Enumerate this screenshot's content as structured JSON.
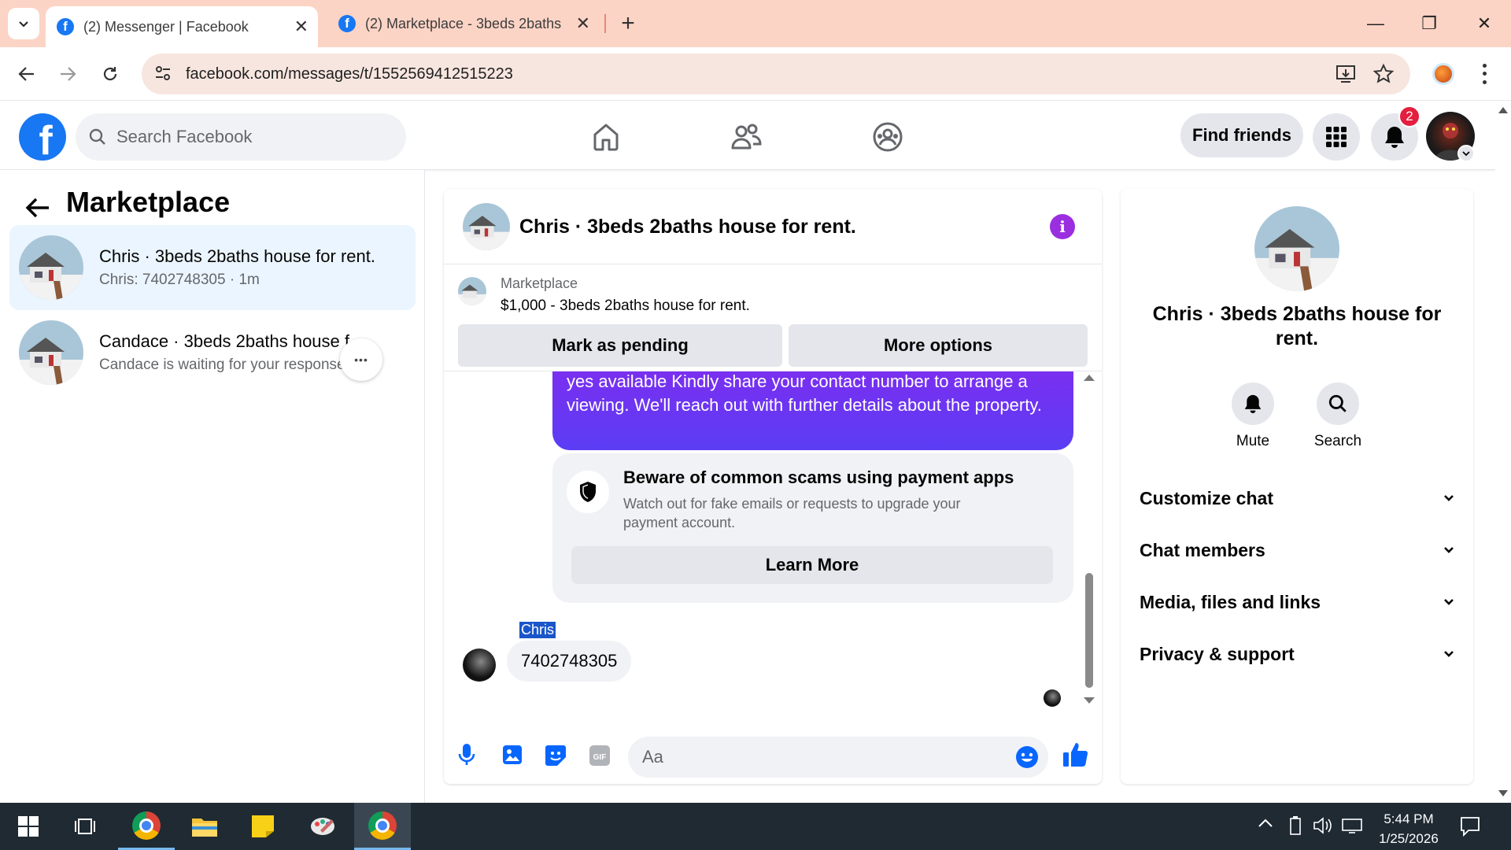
{
  "browser": {
    "tabs": [
      {
        "title": "(2) Messenger | Facebook",
        "active": true
      },
      {
        "title": "(2) Marketplace - 3beds 2baths",
        "active": false
      }
    ],
    "url": "facebook.com/messages/t/1552569412515223",
    "new_tab_label": "+",
    "tab_close_glyph": "✕",
    "tab_list_glyph": "⌄",
    "window": {
      "minimize": "—",
      "restore": "❐",
      "close": "✕"
    }
  },
  "facebook_header": {
    "logo_letter": "f",
    "search_placeholder": "Search Facebook",
    "find_friends_label": "Find friends",
    "notification_count": "2",
    "accent": "#1877f2"
  },
  "left_panel": {
    "title": "Marketplace",
    "conversations": [
      {
        "name": "Chris · 3beds 2baths house for rent.",
        "preview": "Chris: 7402748305 · 1m",
        "active": true
      },
      {
        "name": "Candace · 3beds 2baths house f…",
        "preview": "Candace is waiting for your response · 1m",
        "active": false
      }
    ],
    "more_glyph": "•••"
  },
  "chat": {
    "title": "Chris · 3beds 2baths house for rent.",
    "info_glyph": "i",
    "marketplace_label": "Marketplace",
    "listing": "$1,000 - 3beds 2baths house for rent.",
    "mark_pending_label": "Mark as pending",
    "more_options_label": "More options",
    "outgoing_message": "yes available Kindly share your contact number to arrange a viewing. We'll reach out with further details about the property.",
    "scam_card": {
      "title": "Beware of common scams using payment apps",
      "body": "Watch out for fake emails or requests to upgrade your payment account.",
      "button": "Learn More"
    },
    "incoming_sender": "Chris",
    "incoming_message": "7402748305",
    "input_placeholder": "Aa",
    "bubble_color": "#6c2ff6"
  },
  "right_panel": {
    "name": "Chris · 3beds 2baths house for rent.",
    "actions": [
      {
        "label": "Mute"
      },
      {
        "label": "Search"
      }
    ],
    "sections": [
      "Customize chat",
      "Chat members",
      "Media, files and links",
      "Privacy & support"
    ],
    "chevron_glyph": "⌄"
  },
  "taskbar": {
    "time": "5:44 PM",
    "date": "1/25/2026"
  }
}
